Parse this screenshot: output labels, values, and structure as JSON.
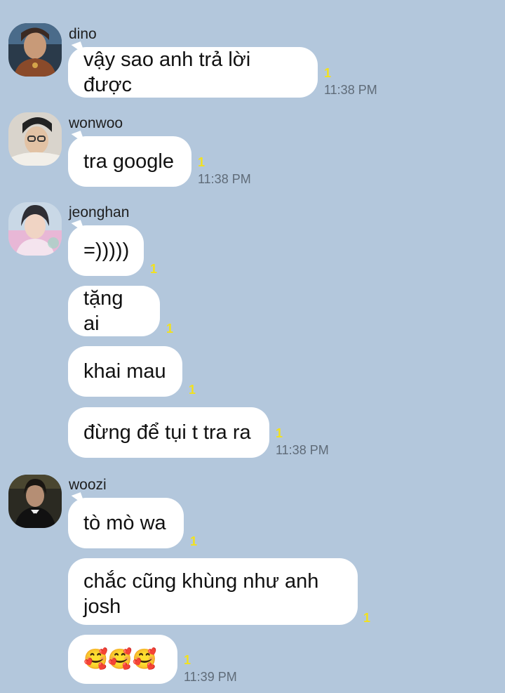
{
  "messages": [
    {
      "sender": "dino",
      "avatar": "dino-avatar",
      "bubbles": [
        {
          "text": "vậy sao anh trả lời được",
          "unread": "1",
          "time": "11:38 PM"
        }
      ]
    },
    {
      "sender": "wonwoo",
      "avatar": "wonwoo-avatar",
      "bubbles": [
        {
          "text": "tra google",
          "unread": "1",
          "time": "11:38 PM"
        }
      ]
    },
    {
      "sender": "jeonghan",
      "avatar": "jeonghan-avatar",
      "bubbles": [
        {
          "text": "=)))))",
          "unread": "1"
        },
        {
          "text": "tặng ai",
          "unread": "1"
        },
        {
          "text": "khai mau",
          "unread": "1"
        },
        {
          "text": "đừng để tụi t tra ra",
          "unread": "1",
          "time": "11:38 PM"
        }
      ]
    },
    {
      "sender": "woozi",
      "avatar": "woozi-avatar",
      "bubbles": [
        {
          "text": "tò mò wa",
          "unread": "1"
        },
        {
          "text": "chắc cũng khùng như anh josh",
          "unread": "1"
        },
        {
          "text": "🥰🥰🥰",
          "unread": "1",
          "time": "11:39 PM"
        }
      ]
    }
  ],
  "colors": {
    "background": "#b3c7dc",
    "bubble": "#ffffff",
    "unread": "#f2e11e",
    "time": "#5f6b78"
  }
}
